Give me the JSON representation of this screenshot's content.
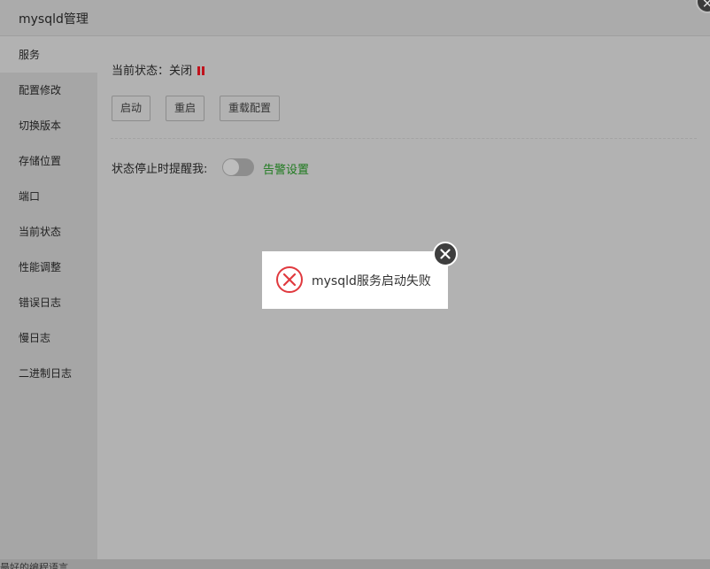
{
  "window": {
    "title": "mysqld管理",
    "close_glyph": "✕"
  },
  "sidebar": {
    "items": [
      {
        "label": "服务",
        "active": true
      },
      {
        "label": "配置修改"
      },
      {
        "label": "切换版本"
      },
      {
        "label": "存储位置"
      },
      {
        "label": "端口"
      },
      {
        "label": "当前状态"
      },
      {
        "label": "性能调整"
      },
      {
        "label": "错误日志"
      },
      {
        "label": "慢日志"
      },
      {
        "label": "二进制日志"
      }
    ]
  },
  "service": {
    "status_label": "当前状态：",
    "status_value": "关闭",
    "status_icon": "pause-icon",
    "status_color": "#c0121c",
    "buttons": {
      "start": "启动",
      "restart": "重启",
      "reload": "重载配置"
    },
    "alert_label": "状态停止时提醒我:",
    "alert_toggle_on": false,
    "alert_settings_link": "告警设置",
    "alert_settings_color": "#1e7a1e"
  },
  "toast": {
    "icon": "error-circle-icon",
    "message": "mysqld服务启动失败",
    "icon_color": "#e0393e"
  },
  "background": {
    "bottom_text": "最好的编程语言"
  }
}
